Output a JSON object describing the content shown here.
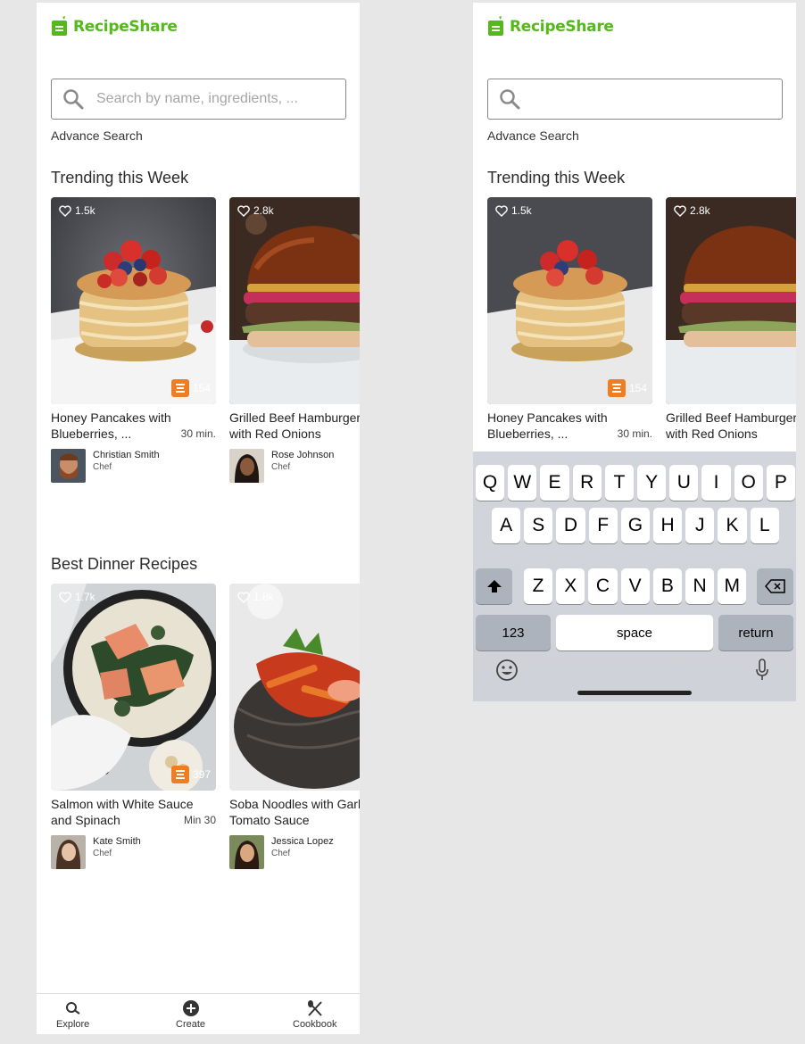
{
  "app": {
    "name": "RecipeShare",
    "brand_color": "#55b81b",
    "accent_color": "#ef7d22"
  },
  "search": {
    "placeholder": "Search by name, ingredients, ...",
    "value": ""
  },
  "advance_search_label": "Advance Search",
  "sections": [
    {
      "title": "Trending this Week",
      "cards": [
        {
          "likes": "1.5k",
          "saves": "154",
          "title_line1": "Honey Pancakes with",
          "title_line2": "Blueberries, ...",
          "time": "30 min.",
          "author": "Christian Smith",
          "role": "Chef"
        },
        {
          "likes": "2.8k",
          "saves": "",
          "title_line1": "Grilled Beef Hamburger",
          "title_line2": "with Red Onions",
          "time": "",
          "author": "Rose Johnson",
          "role": "Chef"
        }
      ]
    },
    {
      "title": "Best Dinner Recipes",
      "cards": [
        {
          "likes": "1.7k",
          "saves": "397",
          "title_line1": "Salmon with White Sauce",
          "title_line2": "and Spinach",
          "time": "Min 30",
          "author": "Kate Smith",
          "role": "Chef"
        },
        {
          "likes": "1.8k",
          "saves": "",
          "title_line1": "Soba Noodles with Garlic",
          "title_line2": "Tomato Sauce",
          "time": "",
          "author": "Jessica Lopez",
          "role": "Chef"
        }
      ]
    }
  ],
  "tabs": [
    {
      "label": "Explore",
      "icon": "search-icon"
    },
    {
      "label": "Create",
      "icon": "plus-circle-icon"
    },
    {
      "label": "Cookbook",
      "icon": "utensils-icon"
    }
  ],
  "keyboard": {
    "row1": [
      "Q",
      "W",
      "E",
      "R",
      "T",
      "Y",
      "U",
      "I",
      "O",
      "P"
    ],
    "row2": [
      "A",
      "S",
      "D",
      "F",
      "G",
      "H",
      "J",
      "K",
      "L"
    ],
    "row3": [
      "Z",
      "X",
      "C",
      "V",
      "B",
      "N",
      "M"
    ],
    "numbers_label": "123",
    "space_label": "space",
    "return_label": "return"
  }
}
